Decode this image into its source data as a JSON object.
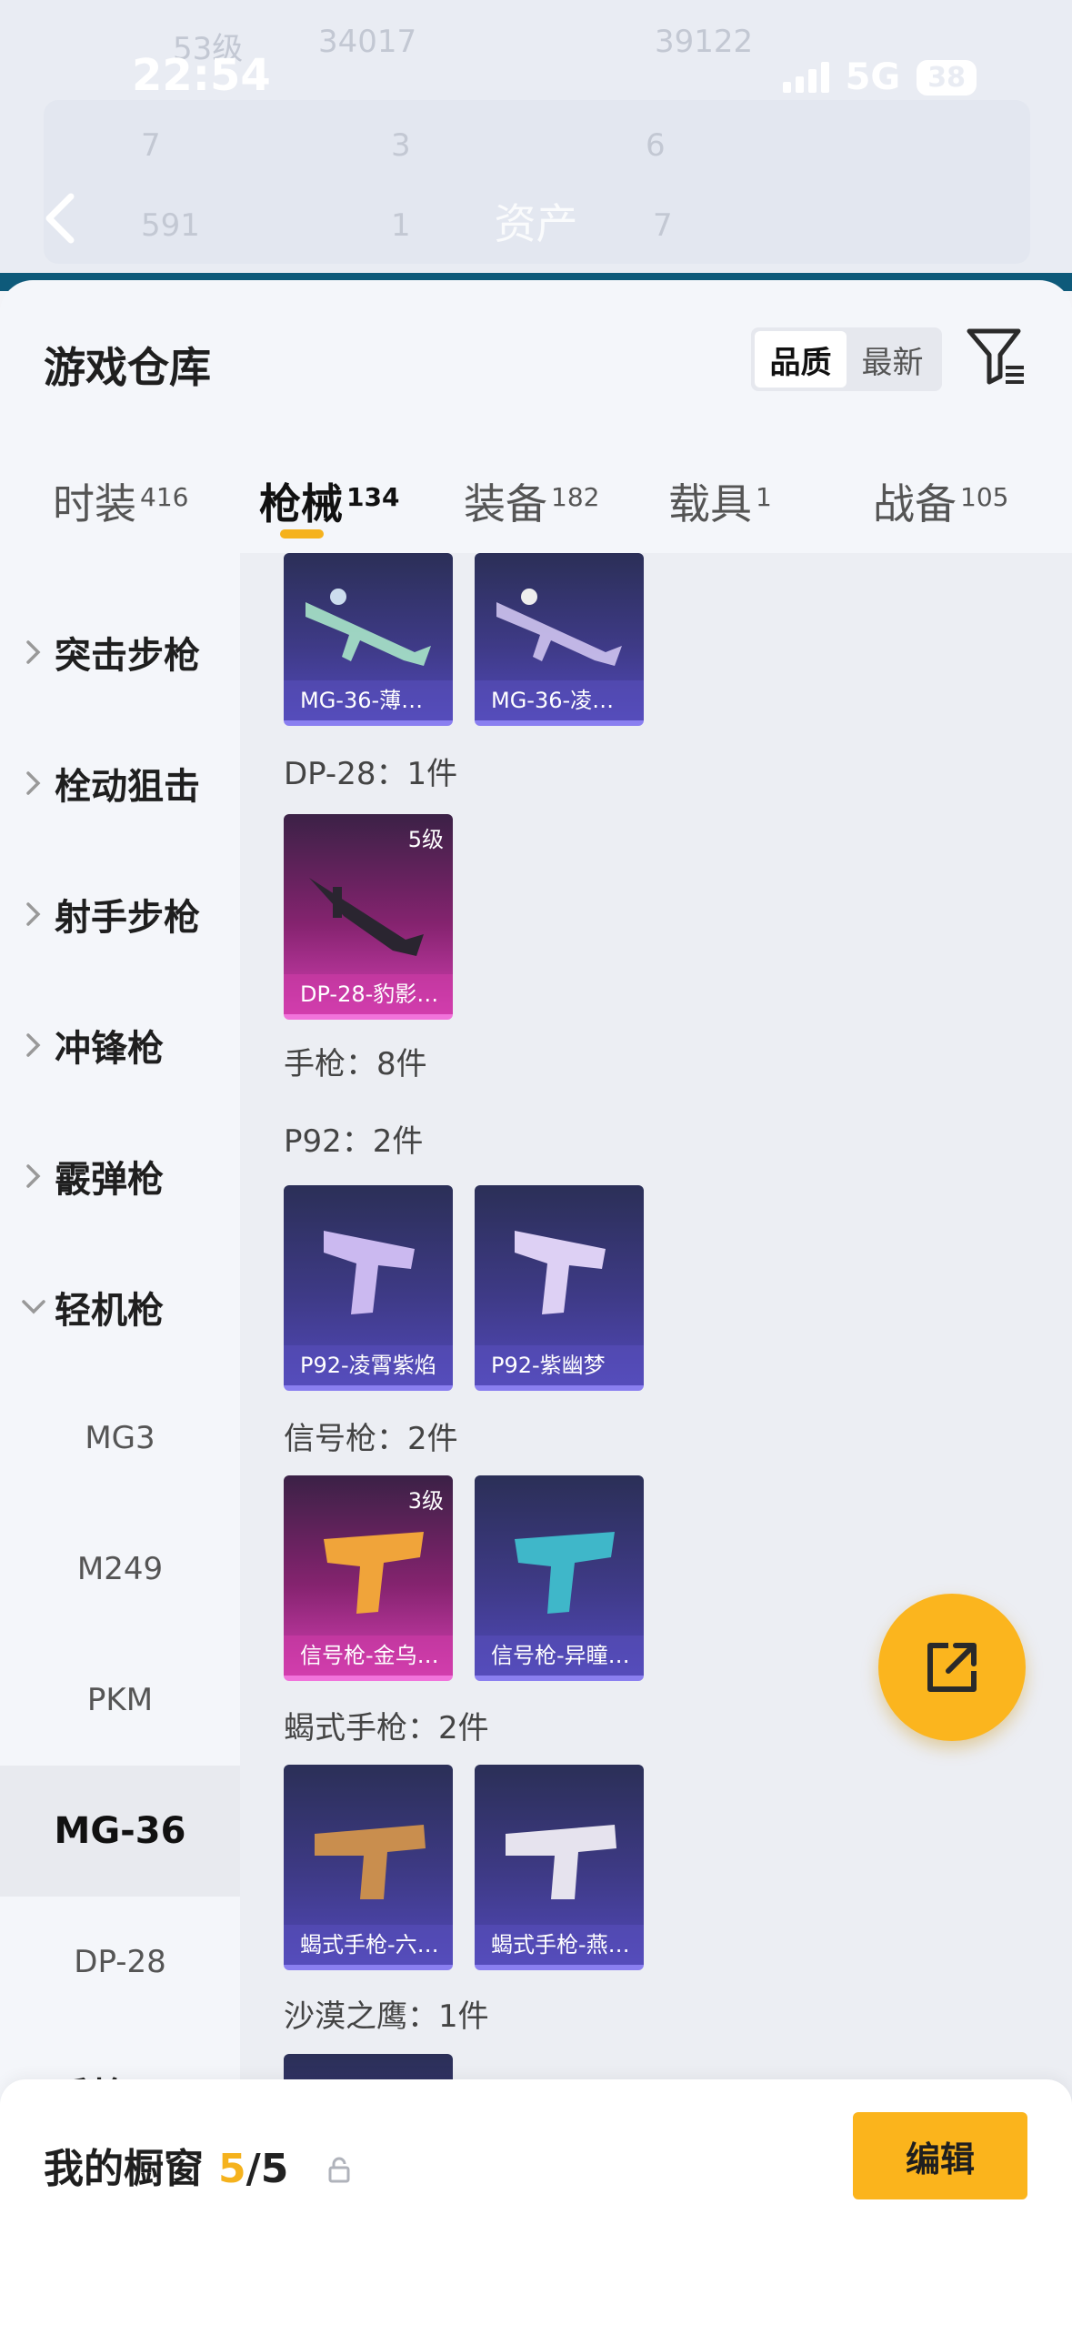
{
  "status_bar": {
    "time": "22:54",
    "network": "5G",
    "battery": "38"
  },
  "header": {
    "title": "资产",
    "faded_stats": [
      "53级",
      "34017",
      "39122",
      "7",
      "3",
      "6",
      "591",
      "1",
      "7"
    ]
  },
  "warehouse": {
    "title": "游戏仓库",
    "sort_options": [
      "品质",
      "最新"
    ],
    "active_sort": "品质",
    "tabs": [
      {
        "label": "时装",
        "count": "416"
      },
      {
        "label": "枪械",
        "count": "134"
      },
      {
        "label": "装备",
        "count": "182"
      },
      {
        "label": "载具",
        "count": "1"
      },
      {
        "label": "战备",
        "count": "105"
      }
    ],
    "active_tab": "枪械"
  },
  "sidebar": {
    "categories": [
      {
        "label": "突击步枪",
        "expanded": false
      },
      {
        "label": "栓动狙击",
        "expanded": false
      },
      {
        "label": "射手步枪",
        "expanded": false
      },
      {
        "label": "冲锋枪",
        "expanded": false
      },
      {
        "label": "霰弹枪",
        "expanded": false
      },
      {
        "label": "轻机枪",
        "expanded": true
      }
    ],
    "subitems": [
      "MG3",
      "M249",
      "PKM",
      "MG-36",
      "DP-28"
    ],
    "selected_subitem": "MG-36",
    "next_category": {
      "label": "手枪",
      "expanded": false
    }
  },
  "content": {
    "groups": [
      {
        "label": "",
        "items": [
          {
            "name": "MG-36-薄…",
            "level": "",
            "color": "blue"
          },
          {
            "name": "MG-36-凌…",
            "level": "",
            "color": "blue"
          }
        ]
      },
      {
        "label": "DP-28：1件",
        "items": [
          {
            "name": "DP-28-豹影…",
            "level": "5级",
            "color": "pink"
          }
        ]
      },
      {
        "label": "手枪：8件",
        "items": []
      },
      {
        "label": "P92：2件",
        "items": [
          {
            "name": "P92-凌霄紫焰",
            "level": "",
            "color": "blue"
          },
          {
            "name": "P92-紫幽梦",
            "level": "",
            "color": "blue"
          }
        ]
      },
      {
        "label": "信号枪：2件",
        "items": [
          {
            "name": "信号枪-金乌…",
            "level": "3级",
            "color": "pink"
          },
          {
            "name": "信号枪-异瞳…",
            "level": "",
            "color": "blue"
          }
        ]
      },
      {
        "label": "蝎式手枪：2件",
        "items": [
          {
            "name": "蝎式手枪-六…",
            "level": "",
            "color": "blue"
          },
          {
            "name": "蝎式手枪-燕…",
            "level": "",
            "color": "blue"
          }
        ]
      },
      {
        "label": "沙漠之鹰：1件",
        "items": []
      }
    ]
  },
  "showcase": {
    "title": "我的橱窗",
    "count_current": "5",
    "count_sep": "/",
    "count_total": "5",
    "edit_label": "编辑"
  },
  "colors": {
    "accent": "#f5b21d",
    "card_blue": "#3e3a86",
    "card_pink": "#85236f"
  },
  "icons": [
    "back-arrow-icon",
    "filter-icon",
    "chevron-right-icon",
    "chevron-down-icon",
    "share-export-icon",
    "lock-icon"
  ]
}
